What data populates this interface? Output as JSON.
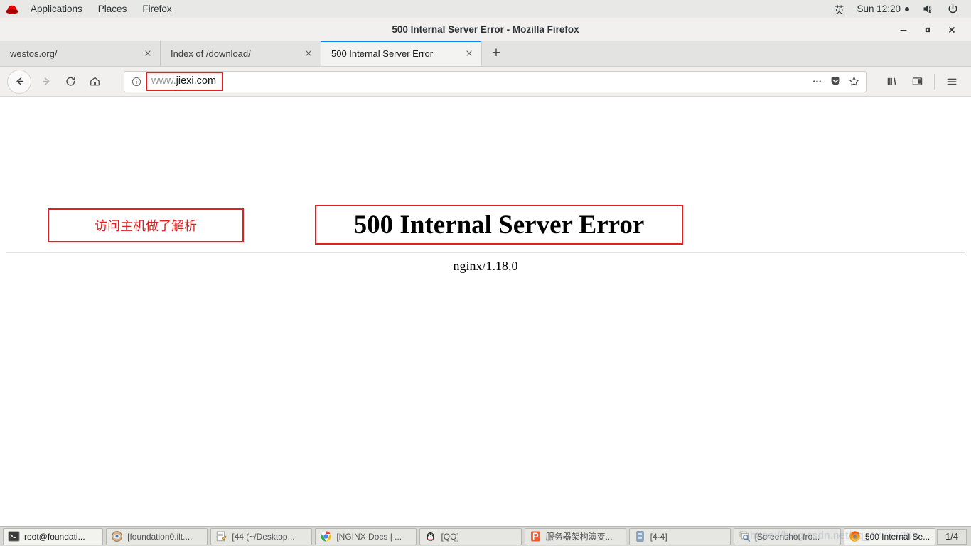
{
  "desktop": {
    "topbar": {
      "logo": "red-hat-logo",
      "menus": [
        "Applications",
        "Places",
        "Firefox"
      ],
      "input_method": "英",
      "clock": "Sun 12:20",
      "volume_icon": "volume-muted-icon",
      "power_icon": "power-icon"
    },
    "taskbar": {
      "items": [
        {
          "label": "root@foundati...",
          "icon": "terminal-icon",
          "active": true
        },
        {
          "label": "[foundation0.ilt....",
          "icon": "image-viewer-icon",
          "active": false
        },
        {
          "label": "[44 (~/Desktop...",
          "icon": "text-editor-icon",
          "active": false
        },
        {
          "label": "[NGINX Docs | ...",
          "icon": "chrome-icon",
          "active": false
        },
        {
          "label": "[QQ]",
          "icon": "qq-penguin-icon",
          "active": false
        },
        {
          "label": "服务器架构演变...",
          "icon": "wps-presentation-icon",
          "active": false
        },
        {
          "label": "[4-4]",
          "icon": "archive-icon",
          "active": false
        },
        {
          "label": "[Screenshot fro...",
          "icon": "screenshot-icon",
          "active": false
        },
        {
          "label": "500 Internal Se...",
          "icon": "firefox-icon",
          "active": true
        }
      ],
      "workspace": "1/4",
      "watermark": "https://blog.csdn.net/qq_47714289"
    }
  },
  "browser": {
    "window_title": "500 Internal Server Error - Mozilla Firefox",
    "window_controls": {
      "minimize": "minimize-icon",
      "maximize": "maximize-icon",
      "close": "close-icon"
    },
    "tabs": [
      {
        "title": "westos.org/",
        "active": false
      },
      {
        "title": "Index of /download/",
        "active": false
      },
      {
        "title": "500 Internal Server Error",
        "active": true
      }
    ],
    "new_tab_label": "+",
    "nav": {
      "back": "back-icon",
      "forward": "forward-icon",
      "reload": "reload-icon",
      "home": "home-icon"
    },
    "urlbar": {
      "identity_icon": "info-icon",
      "url_prefix": "www.",
      "url_domain": "jiexi.com",
      "page_actions_icon": "ellipsis-icon",
      "pocket_icon": "pocket-icon",
      "bookmark_icon": "star-icon"
    },
    "toolbar_right": {
      "library": "library-icon",
      "sidebar": "sidebar-icon",
      "menu": "hamburger-menu-icon"
    }
  },
  "page": {
    "heading": "500 Internal Server Error",
    "server_signature": "nginx/1.18.0",
    "annotation": {
      "text": "访问主机做了解析",
      "color": "#e02020"
    }
  },
  "colors": {
    "annotation_red": "#e02020",
    "active_tab_accent": "#0a84ff",
    "topbar_bg": "#e8e8e6",
    "taskbar_bg": "#d8d8d4"
  }
}
